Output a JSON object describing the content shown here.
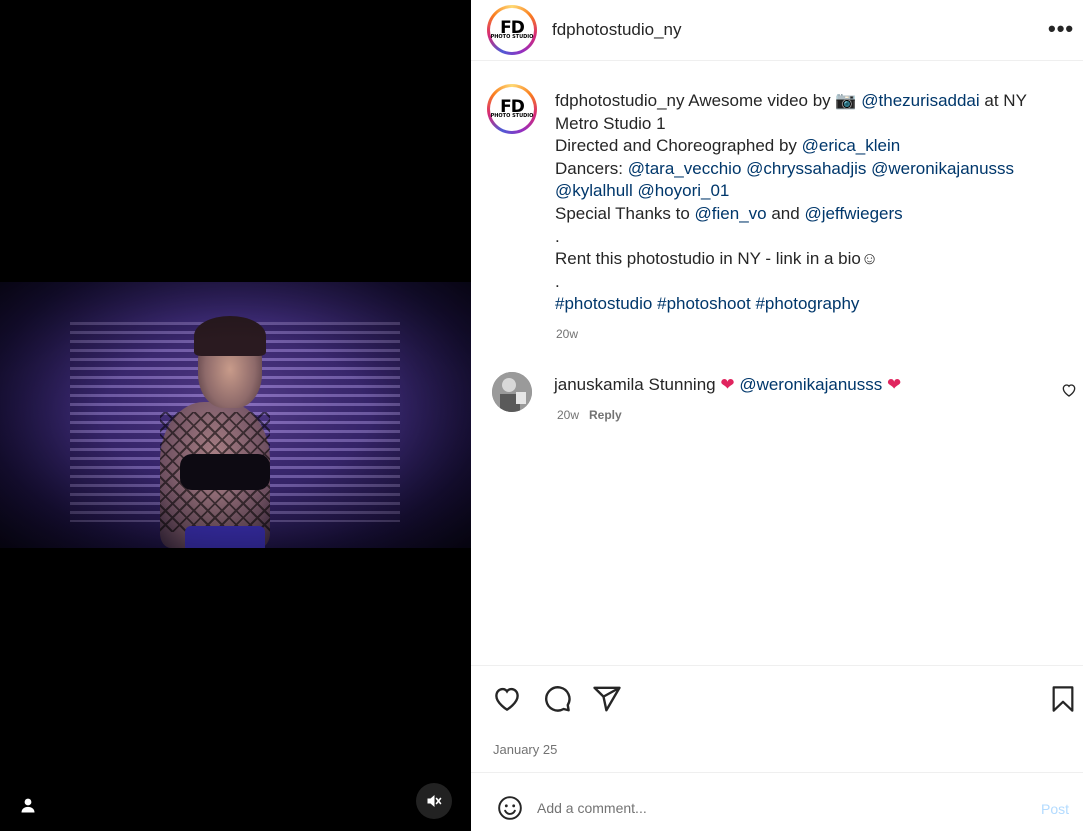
{
  "post": {
    "username": "fdphotostudio_ny",
    "logo_text": "FD",
    "logo_sub": "PHOTO STUDIO",
    "more_label": "•••",
    "date": "January 25"
  },
  "caption": {
    "username": "fdphotostudio_ny",
    "line1_text": " Awesome video by 📷 ",
    "line1_mention": "@thezurisaddai",
    "line1_rest": " at NY Metro Studio 1",
    "line2_text": "Directed and Choreographed by ",
    "line2_mention": "@erica_klein",
    "line3_text": "Dancers: ",
    "dancer1": "@tara_vecchio",
    "dancer2": "@chryssahadjis",
    "dancer3": "@weronikajanusss",
    "dancer4": "@kylalhull",
    "dancer5": "@hoyori_01",
    "line4_text": "Special Thanks to ",
    "thanks1": "@fien_vo",
    "and": " and ",
    "thanks2": "@jeffwiegers",
    "dot1": ".",
    "rent": "Rent this photostudio in NY - link in a bio☺",
    "dot2": ".",
    "tag1": "#photostudio",
    "tag2": "#photoshoot",
    "tag3": "#photography",
    "time": "20w"
  },
  "comments": [
    {
      "username": "januskamila",
      "text": " Stunning ",
      "heart1": "❤",
      "mention": "@weronikajanusss",
      "heart2": "❤",
      "time": "20w",
      "reply_label": "Reply"
    }
  ],
  "composer": {
    "emoji_icon": "smiley-icon",
    "placeholder": "Add a comment...",
    "post_label": "Post"
  },
  "colors": {
    "link": "#00376b",
    "muted": "#737373",
    "post_disabled": "#b3dbff",
    "heart": "#e0245e"
  }
}
